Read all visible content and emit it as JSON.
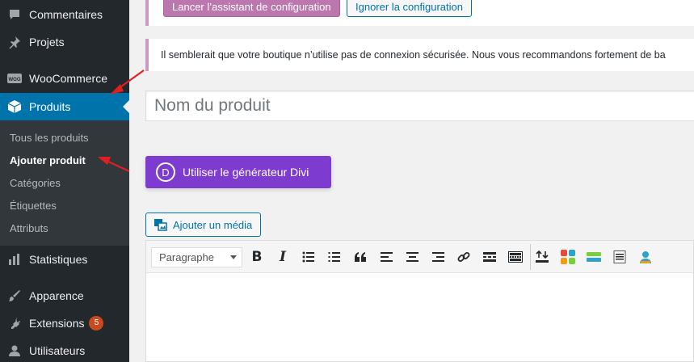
{
  "sidebar": {
    "items": [
      {
        "label": "Commentaires",
        "icon": "comment-icon"
      },
      {
        "label": "Projets",
        "icon": "pin-icon"
      },
      {
        "label": "WooCommerce",
        "icon": "woocommerce-icon"
      },
      {
        "label": "Produits",
        "icon": "box-icon"
      },
      {
        "label": "Statistiques",
        "icon": "bar-chart-icon"
      },
      {
        "label": "Apparence",
        "icon": "brush-icon"
      },
      {
        "label": "Extensions",
        "icon": "plug-icon",
        "badge": "5"
      },
      {
        "label": "Utilisateurs",
        "icon": "user-icon"
      }
    ],
    "submenu": [
      "Tous les produits",
      "Ajouter produit",
      "Catégories",
      "Étiquettes",
      "Attributs"
    ]
  },
  "notice": {
    "setup_button": "Lancer l’assistant de configuration",
    "skip_button": "Ignorer la configuration",
    "ssl_message": "Il semblerait que votre boutique n’utilise pas de connexion sécurisée. Nous vous recommandons fortement de ba"
  },
  "editor": {
    "title_placeholder": "Nom du produit",
    "divi_button": "Utiliser le générateur Divi",
    "divi_logo": "D",
    "add_media": "Ajouter un média",
    "format_value": "Paragraphe",
    "bold": "B",
    "italic": "I"
  },
  "colors": {
    "sidebar_bg": "#23282d",
    "active": "#0073aa",
    "divi": "#7e3bd0",
    "woo_purple": "#bb77ae",
    "badge": "#ca4a1f"
  }
}
